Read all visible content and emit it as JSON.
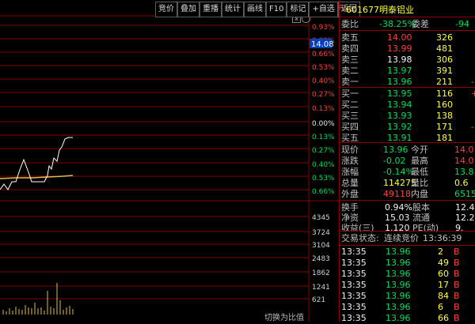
{
  "toolbar": {
    "buttons": [
      "竞价",
      "叠加",
      "重播",
      "统计",
      "画线",
      "F10",
      "标记",
      "+自选",
      "返回"
    ]
  },
  "chart": {
    "right_axis": [
      "0.93%",
      "0.80%",
      "0.66%",
      "0.53%",
      "0.40%",
      "0.27%",
      "0.13%",
      "0.00%",
      "0.13%",
      "0.27%",
      "0.40%",
      "0.53%",
      "0.66%"
    ],
    "price_tag": "14.08",
    "volume_axis": [
      "4345",
      "3724",
      "3104",
      "2483",
      "1862",
      "1241",
      "621"
    ],
    "bottom_label": "切换为比值"
  },
  "header": {
    "code": "601677",
    "name": "明泰铝业",
    "badge": "R"
  },
  "ratio": {
    "label1": "委比",
    "value1": "-38.25%",
    "label2": "委差",
    "value2": "-94"
  },
  "sell": [
    {
      "label": "卖五",
      "price": "14.00",
      "vol": "326"
    },
    {
      "label": "卖四",
      "price": "13.99",
      "vol": "481"
    },
    {
      "label": "卖三",
      "price": "13.98",
      "vol": "306"
    },
    {
      "label": "卖二",
      "price": "13.97",
      "vol": "391"
    },
    {
      "label": "卖一",
      "price": "13.96",
      "vol": "211",
      "chg": "-"
    }
  ],
  "buy": [
    {
      "label": "买一",
      "price": "13.95",
      "vol": "116",
      "chg": "+"
    },
    {
      "label": "买二",
      "price": "13.94",
      "vol": "160"
    },
    {
      "label": "买三",
      "price": "13.93",
      "vol": "138"
    },
    {
      "label": "买四",
      "price": "13.92",
      "vol": "171",
      "chg": "-"
    },
    {
      "label": "买五",
      "price": "13.91",
      "vol": "181"
    }
  ],
  "stats": [
    {
      "l1": "现价",
      "v1": "13.96",
      "l2": "今开",
      "v2": "14.0"
    },
    {
      "l1": "涨跌",
      "v1": "-0.02",
      "l2": "最高",
      "v2": "14.0"
    },
    {
      "l1": "涨幅",
      "v1": "-0.14%",
      "l2": "最低",
      "v2": "13.8"
    },
    {
      "l1": "总量",
      "v1": "114275",
      "l2": "量比",
      "v2": "0.6"
    },
    {
      "l1": "外盘",
      "v1": "49118",
      "l2": "内盘",
      "v2": "6515"
    }
  ],
  "stats2": [
    {
      "l1": "换手",
      "v1": "0.94%",
      "l2": "股本",
      "v2": "12.4"
    },
    {
      "l1": "净资",
      "v1": "15.03",
      "l2": "流通",
      "v2": "12.2"
    },
    {
      "l1": "收益(三)",
      "v1": "1.120",
      "l2": "PE(动)",
      "v2": "9."
    }
  ],
  "trade_status": {
    "label": "交易状态:",
    "value": "连续竞价",
    "time": "13:36:39"
  },
  "ticks": [
    {
      "time": "13:35",
      "price": "13.96",
      "vol": "2",
      "side": "B"
    },
    {
      "time": "13:35",
      "price": "13.96",
      "vol": "49",
      "side": "B"
    },
    {
      "time": "13:35",
      "price": "13.96",
      "vol": "60",
      "side": "B"
    },
    {
      "time": "13:35",
      "price": "13.96",
      "vol": "17",
      "side": "B"
    },
    {
      "time": "13:35",
      "price": "13.96",
      "vol": "84",
      "side": "B"
    },
    {
      "time": "13:35",
      "price": "13.96",
      "vol": "6",
      "side": "B"
    },
    {
      "time": "13:35",
      "price": "13.96",
      "vol": "66",
      "side": "B"
    }
  ],
  "colors": {
    "grid": "#8a0000",
    "up": "#ff4040",
    "down": "#00e060",
    "price_line": "#ffffff",
    "avg_line": "#e0c040"
  }
}
